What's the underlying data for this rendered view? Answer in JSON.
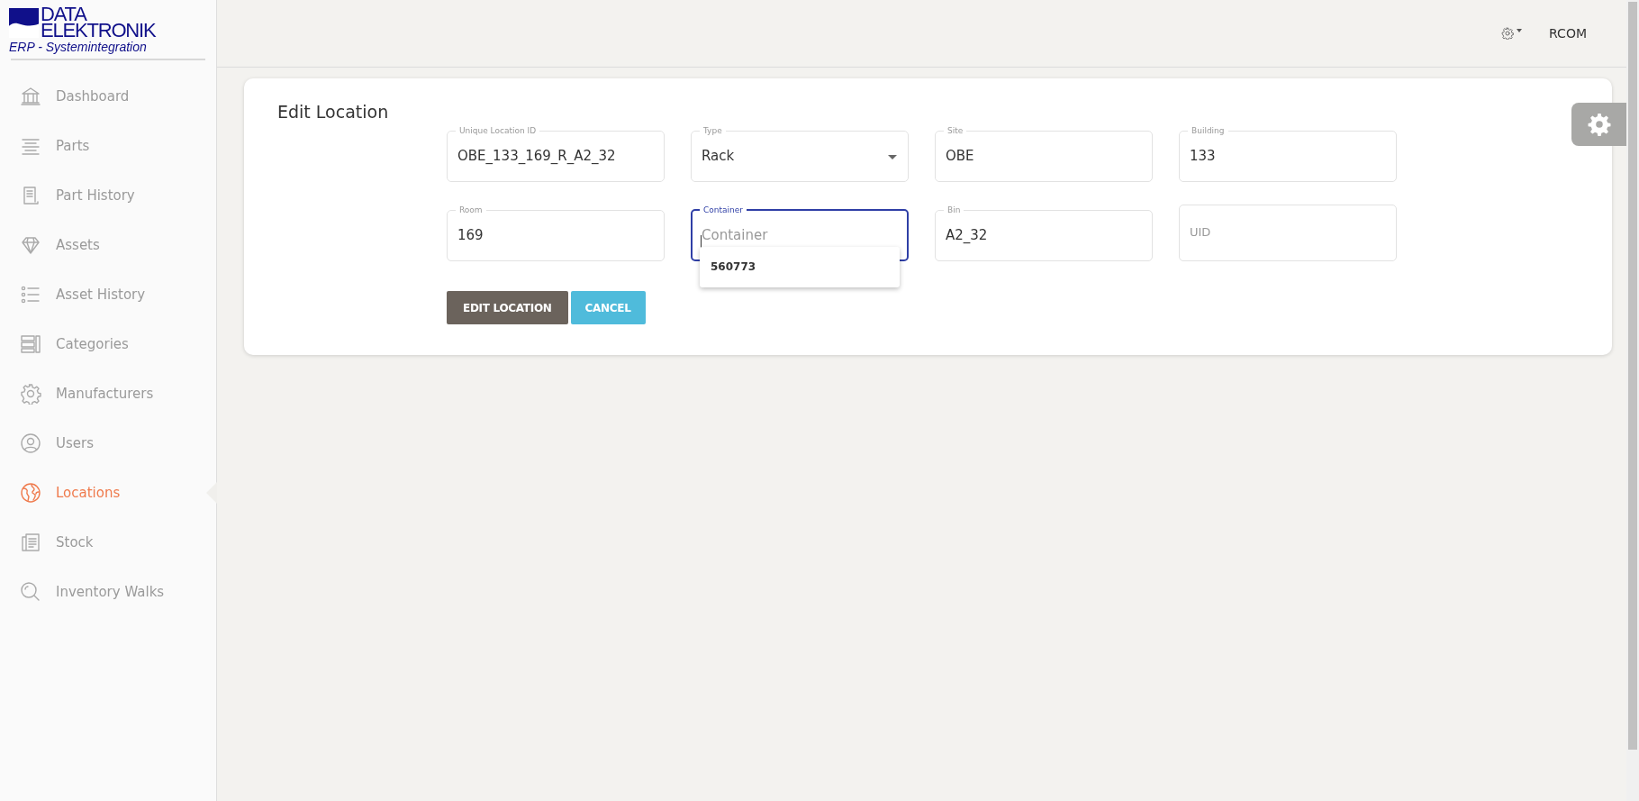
{
  "logo": {
    "line_1": "DATA",
    "line_2": "ELEKTRONIK",
    "tagline": "ERP - Systemintegration"
  },
  "sidebar": {
    "items": [
      {
        "label": "Dashboard",
        "selected": false
      },
      {
        "label": "Parts",
        "selected": false
      },
      {
        "label": "Part History",
        "selected": false
      },
      {
        "label": "Assets",
        "selected": false
      },
      {
        "label": "Asset History",
        "selected": false
      },
      {
        "label": "Categories",
        "selected": false
      },
      {
        "label": "Manufacturers",
        "selected": false
      },
      {
        "label": "Users",
        "selected": false
      },
      {
        "label": "Locations",
        "selected": true
      },
      {
        "label": "Stock",
        "selected": false
      },
      {
        "label": "Inventory Walks",
        "selected": false
      }
    ]
  },
  "top_bar": {
    "user": "RCOM"
  },
  "form": {
    "title": "Edit Location",
    "fields": [
      {
        "kind": "text",
        "label": "Unique Location ID",
        "value": "OBE_133_169_R_A2_32",
        "focused": false
      },
      {
        "kind": "select",
        "label": "Type",
        "value": "Rack",
        "focused": false
      },
      {
        "kind": "text",
        "label": "Site",
        "value": "OBE",
        "focused": false
      },
      {
        "kind": "text",
        "label": "Building",
        "value": "133",
        "focused": false
      },
      {
        "kind": "text",
        "label": "Room",
        "value": "169",
        "focused": false
      },
      {
        "kind": "text",
        "label": "Container",
        "placeholder": "Container",
        "focused": true,
        "suggestions": [
          "560773"
        ]
      },
      {
        "kind": "text",
        "label": "Bin",
        "value": "A2_32",
        "focused": false
      },
      {
        "kind": "text",
        "placeholder": "UID",
        "focused": false
      }
    ],
    "buttons": [
      {
        "kind": "primary",
        "label": "EDIT LOCATION"
      },
      {
        "kind": "secondary",
        "label": "CANCEL"
      }
    ]
  }
}
